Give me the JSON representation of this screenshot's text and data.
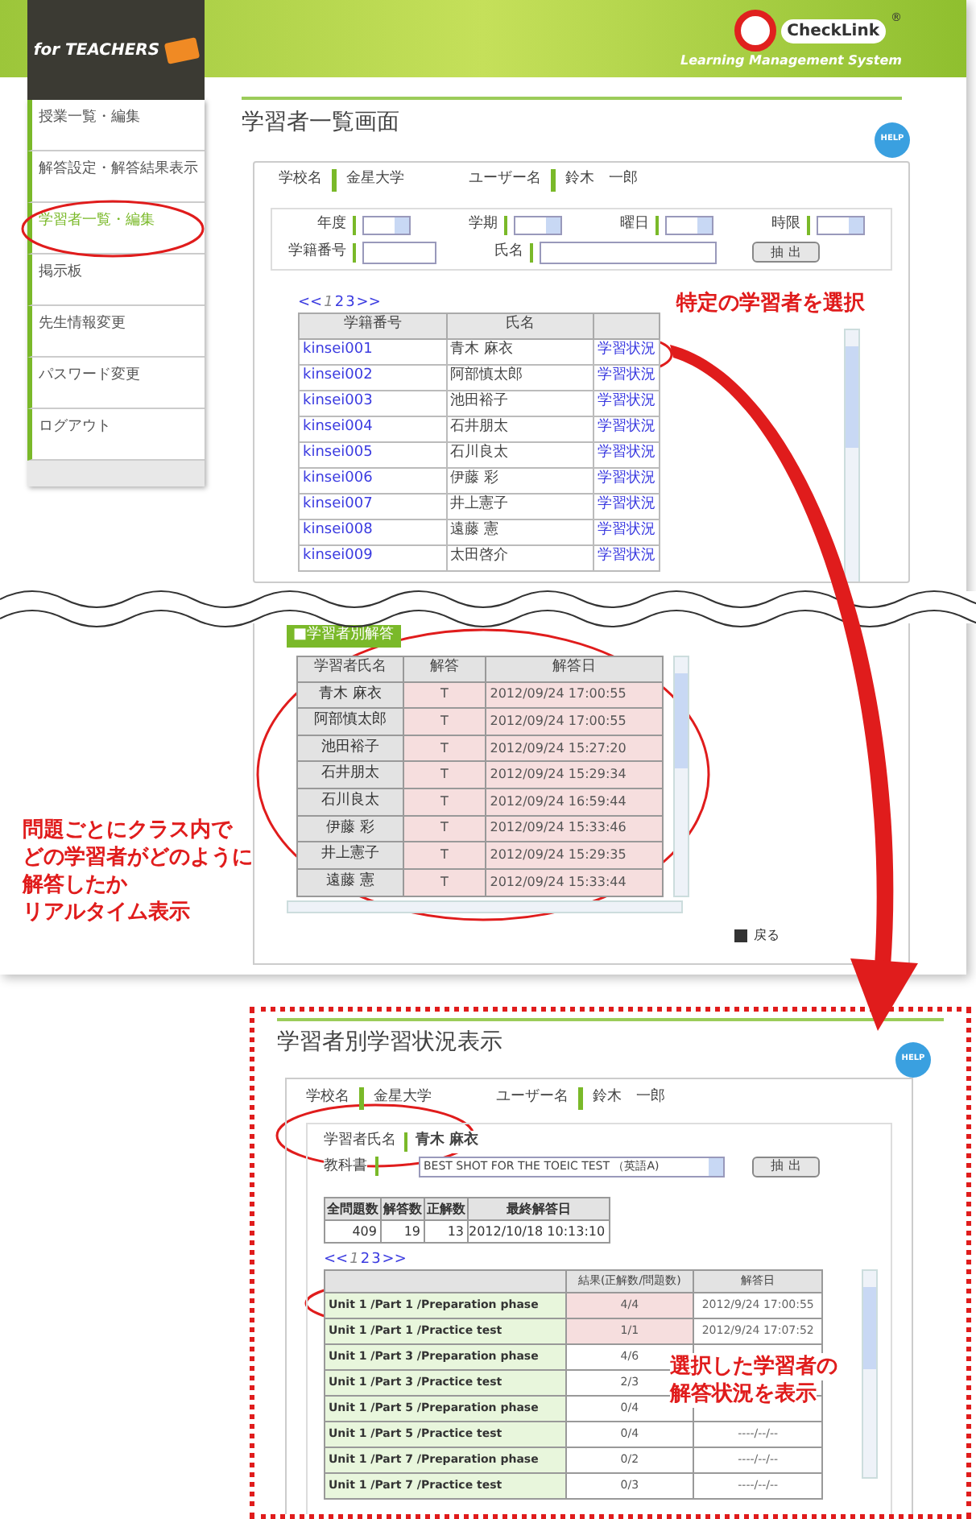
{
  "header": {
    "badge": "for TEACHERS",
    "logo": "CheckLink",
    "logo_mark": "®",
    "tagline": "Learning Management System"
  },
  "sidebar": {
    "items": [
      {
        "label": "授業一覧・編集",
        "selected": false
      },
      {
        "label": "解答設定・解答結果表示",
        "selected": false
      },
      {
        "label": "学習者一覧・編集",
        "selected": true
      },
      {
        "label": "掲示板",
        "selected": false
      },
      {
        "label": "先生情報変更",
        "selected": false
      },
      {
        "label": "パスワード変更",
        "selected": false
      },
      {
        "label": "ログアウト",
        "selected": false
      }
    ]
  },
  "student_list": {
    "title": "学習者一覧画面",
    "help": "HELP",
    "info": [
      {
        "label": "学校名",
        "value": "金星大学"
      },
      {
        "label": "ユーザー名",
        "value": "鈴木　一郎"
      }
    ],
    "filters": [
      {
        "label": "年度",
        "kind": "select"
      },
      {
        "label": "学期",
        "kind": "select"
      },
      {
        "label": "曜日",
        "kind": "select"
      },
      {
        "label": "時限",
        "kind": "select"
      },
      {
        "label": "学籍番号",
        "kind": "text"
      },
      {
        "label": "氏名",
        "kind": "text"
      }
    ],
    "extract_button": "抽 出",
    "pagination": [
      {
        "label": "<<",
        "selected": false
      },
      {
        "label": "1",
        "selected": true
      },
      {
        "label": "2",
        "selected": false
      },
      {
        "label": "3",
        "selected": false
      },
      {
        "label": ">>",
        "selected": false
      }
    ],
    "columns": [
      "学籍番号",
      "氏名"
    ],
    "rows": [
      {
        "id": "kinsei001",
        "name": "青木 麻衣",
        "link": "学習状況"
      },
      {
        "id": "kinsei002",
        "name": "阿部慎太郎",
        "link": "学習状況"
      },
      {
        "id": "kinsei003",
        "name": "池田裕子",
        "link": "学習状況"
      },
      {
        "id": "kinsei004",
        "name": "石井朋太",
        "link": "学習状況"
      },
      {
        "id": "kinsei005",
        "name": "石川良太",
        "link": "学習状況"
      },
      {
        "id": "kinsei006",
        "name": "伊藤 彩",
        "link": "学習状況"
      },
      {
        "id": "kinsei007",
        "name": "井上憲子",
        "link": "学習状況"
      },
      {
        "id": "kinsei008",
        "name": "遠藤 憲",
        "link": "学習状況"
      },
      {
        "id": "kinsei009",
        "name": "太田啓介",
        "link": "学習状況"
      }
    ]
  },
  "answers": {
    "tag": "■学習者別解答",
    "columns": [
      "学習者氏名",
      "解答",
      "解答日"
    ],
    "rows": [
      {
        "name": "青木 麻衣",
        "answer": "T",
        "date": "2012/09/24 17:00:55"
      },
      {
        "name": "阿部慎太郎",
        "answer": "T",
        "date": "2012/09/24 17:00:55"
      },
      {
        "name": "池田裕子",
        "answer": "T",
        "date": "2012/09/24 15:27:20"
      },
      {
        "name": "石井朋太",
        "answer": "T",
        "date": "2012/09/24 15:29:34"
      },
      {
        "name": "石川良太",
        "answer": "T",
        "date": "2012/09/24 16:59:44"
      },
      {
        "name": "伊藤 彩",
        "answer": "T",
        "date": "2012/09/24 15:33:46"
      },
      {
        "name": "井上憲子",
        "answer": "T",
        "date": "2012/09/24 15:29:35"
      },
      {
        "name": "遠藤 憲",
        "answer": "T",
        "date": "2012/09/24 15:33:44"
      }
    ],
    "back": "戻る"
  },
  "student_status": {
    "title": "学習者別学習状況表示",
    "help": "HELP",
    "info": [
      {
        "label": "学校名",
        "value": "金星大学"
      },
      {
        "label": "ユーザー名",
        "value": "鈴木　一郎"
      }
    ],
    "student": {
      "label": "学習者氏名",
      "value": "青木 麻衣"
    },
    "textbook": {
      "label": "教科書",
      "value": "BEST SHOT FOR THE TOEIC TEST （英語A)"
    },
    "extract_button": "抽 出",
    "stats_columns": [
      "全問題数",
      "解答数",
      "正解数",
      "最終解答日"
    ],
    "stats_values": [
      "409",
      "19",
      "13",
      "2012/10/18 10:13:10"
    ],
    "pagination": [
      {
        "label": "<<",
        "selected": false
      },
      {
        "label": "1",
        "selected": true
      },
      {
        "label": "2",
        "selected": false
      },
      {
        "label": "3",
        "selected": false
      },
      {
        "label": ">>",
        "selected": false
      }
    ],
    "columns": [
      "結果(正解数/問題数)",
      "解答日"
    ],
    "rows": [
      {
        "unit": "Unit 1 /Part 1 /Preparation phase",
        "result": "4/4",
        "date": "2012/9/24 17:00:55",
        "highlighted": true
      },
      {
        "unit": "Unit 1 /Part 1 /Practice test",
        "result": "1/1",
        "date": "2012/9/24 17:07:52",
        "highlighted": true
      },
      {
        "unit": "Unit 1 /Part 3 /Preparation phase",
        "result": "4/6",
        "highlighted": false
      },
      {
        "unit": "Unit 1 /Part 3 /Practice test",
        "result": "2/3",
        "highlighted": false
      },
      {
        "unit": "Unit 1 /Part 5 /Preparation phase",
        "result": "0/4",
        "highlighted": false
      },
      {
        "unit": "Unit 1 /Part 5 /Practice test",
        "result": "0/4",
        "date": "----/--/--",
        "highlighted": false
      },
      {
        "unit": "Unit 1 /Part 7 /Preparation phase",
        "result": "0/2",
        "date": "----/--/--",
        "highlighted": false
      },
      {
        "unit": "Unit 1 /Part 7 /Practice test",
        "result": "0/3",
        "date": "----/--/--",
        "highlighted": false
      }
    ]
  },
  "annotations": [
    {
      "lines": [
        "特定の学習者を選択"
      ]
    },
    {
      "lines": [
        "問題ごとにクラス内で",
        "どの学習者がどのように",
        "解答したか",
        "リアルタイム表示"
      ]
    },
    {
      "lines": [
        "選択した学習者の",
        "解答状況を表示"
      ]
    }
  ]
}
